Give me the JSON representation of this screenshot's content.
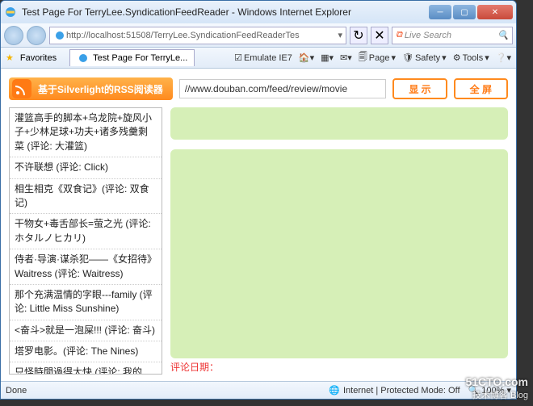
{
  "window": {
    "title": "Test Page For TerryLee.SyndicationFeedReader - Windows Internet Explorer"
  },
  "nav": {
    "url": "http://localhost:51508/TerryLee.SyndicationFeedReaderTes",
    "search_placeholder": "Live Search"
  },
  "favbar": {
    "favorites": "Favorites",
    "tab_title": "Test Page For TerryLe...",
    "emulate": "Emulate IE7",
    "page": "Page",
    "safety": "Safety",
    "tools": "Tools"
  },
  "app": {
    "brand": "基于Silverlight的RSS阅读器",
    "feed_url": "//www.douban.com/feed/review/movie",
    "btn_show": "显 示",
    "btn_full": "全 屏",
    "date_label": "评论日期："
  },
  "feed_items": [
    "灌篮高手的脚本+乌龙院+旋风小子+少林足球+功夫+诸多残羹剩菜 (评论: 大灌篮)",
    "不许联想 (评论: Click)",
    "相生相克《双食记》(评论: 双食记)",
    "干物女+毒舌部长=萤之光 (评论: ホタルノヒカリ)",
    "侍者·导演·谋杀犯——《女招待》Waitress (评论: Waitress)",
    "那个充满温情的字眼---family (评论: Little Miss Sunshine)",
    "<奋斗>就是一泡屎!!! (评论: 奋斗)",
    "塔罗电影。(评论: The Nines)",
    "只怪時間過得太快 (评论: 我的"
  ],
  "status": {
    "done": "Done",
    "zone": "Internet | Protected Mode: Off",
    "zoom": "100%"
  },
  "watermark": {
    "main": "51CTO.com",
    "sub": "技术博客  Blog"
  }
}
